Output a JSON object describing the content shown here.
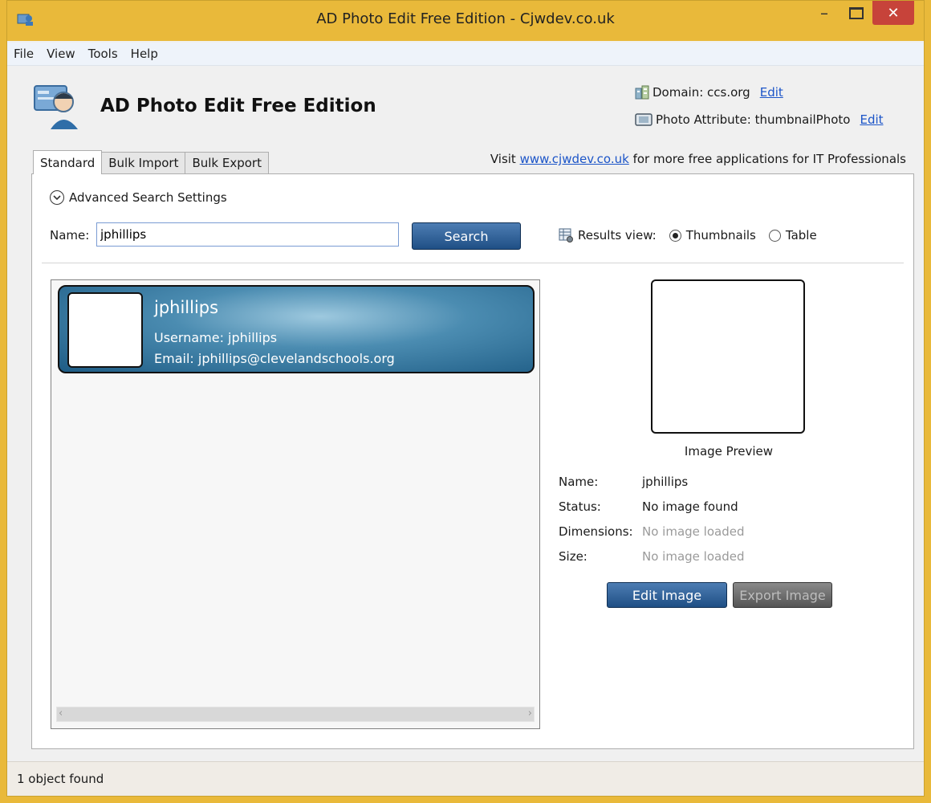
{
  "window": {
    "title": "AD Photo Edit Free Edition - Cjwdev.co.uk",
    "minimize_glyph": "–",
    "close_glyph": "✕"
  },
  "menu": [
    "File",
    "View",
    "Tools",
    "Help"
  ],
  "header": {
    "app_name": "AD Photo Edit Free Edition",
    "domain_label": "Domain: ccs.org",
    "domain_edit": "Edit",
    "attr_label": "Photo Attribute: thumbnailPhoto",
    "attr_edit": "Edit",
    "visit_prefix": "Visit ",
    "visit_link": "www.cjwdev.co.uk",
    "visit_suffix": "for more free applications for IT Professionals"
  },
  "tabs": [
    "Standard",
    "Bulk Import",
    "Bulk Export"
  ],
  "search": {
    "advanced_label": "Advanced Search Settings",
    "name_label": "Name:",
    "name_value": "jphillips",
    "search_button": "Search",
    "results_view_label": "Results view:",
    "option_thumbnails": "Thumbnails",
    "option_table": "Table",
    "selected_view": "Thumbnails"
  },
  "results": [
    {
      "name": "jphillips",
      "username": "Username: jphillips",
      "email": "Email: jphillips@clevelandschools.org"
    }
  ],
  "preview": {
    "label": "Image Preview",
    "name_label": "Name:",
    "name_value": "jphillips",
    "status_label": "Status:",
    "status_value": "No image found",
    "dimensions_label": "Dimensions:",
    "dimensions_value": "No image loaded",
    "size_label": "Size:",
    "size_value": "No image loaded",
    "edit_button": "Edit Image",
    "export_button": "Export Image"
  },
  "status": "1 object found",
  "colors": {
    "title_bar": "#e9b93a",
    "close_button": "#c7433a",
    "primary_button": "#1f4f85",
    "link": "#1c55c8"
  }
}
